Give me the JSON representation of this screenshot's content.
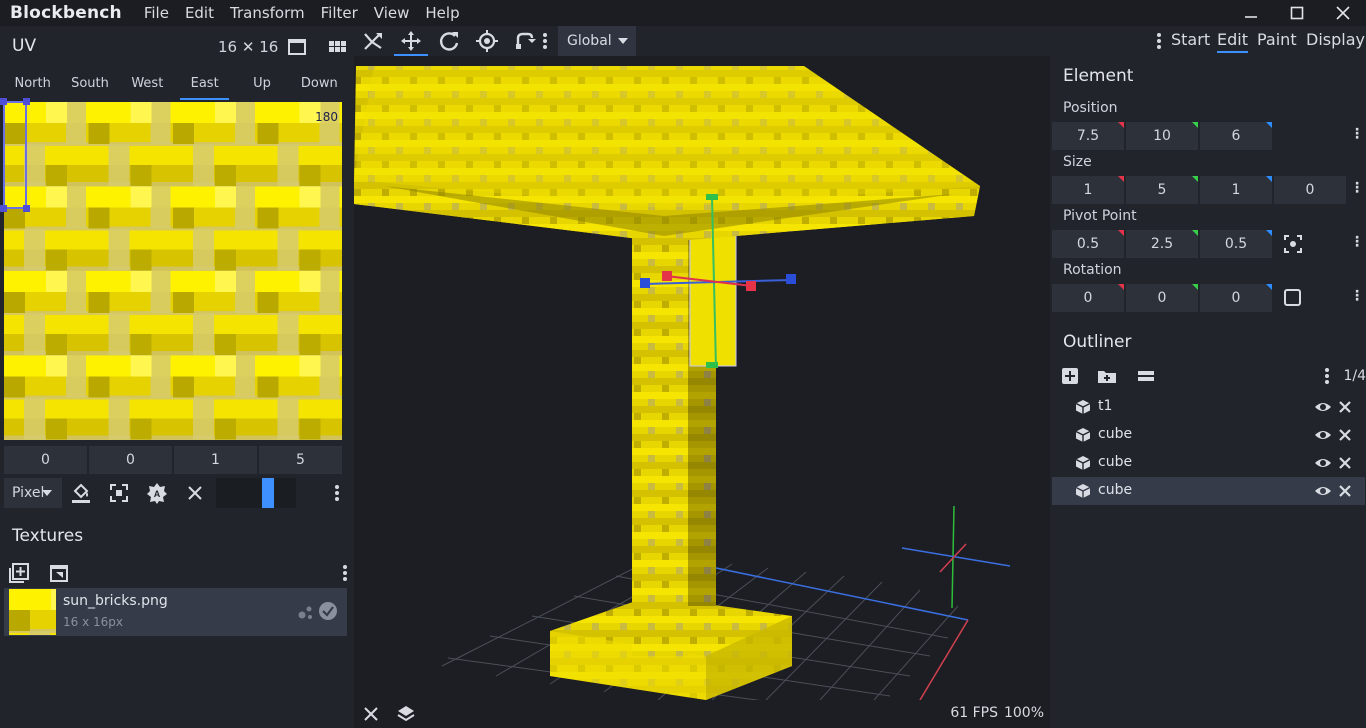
{
  "app": {
    "name": "Blockbench",
    "menu": [
      "File",
      "Edit",
      "Transform",
      "Filter",
      "View",
      "Help"
    ]
  },
  "uv_panel": {
    "title": "UV",
    "size_label": "16 ✕ 16",
    "faces": [
      "North",
      "South",
      "West",
      "East",
      "Up",
      "Down"
    ],
    "active_face": "East",
    "rotation_label": "180",
    "uv_values": [
      "0",
      "0",
      "1",
      "5"
    ],
    "pixel_mode": "Pixel"
  },
  "textures": {
    "title": "Textures",
    "items": [
      {
        "name": "sun_bricks.png",
        "dims": "16 x 16px"
      }
    ]
  },
  "toolbar": {
    "space_select": "Global"
  },
  "modes": {
    "items": [
      "Start",
      "Edit",
      "Paint",
      "Display"
    ],
    "active": "Edit"
  },
  "element": {
    "title": "Element",
    "position_label": "Position",
    "position": [
      "7.5",
      "10",
      "6"
    ],
    "size_label": "Size",
    "size": [
      "1",
      "5",
      "1",
      "0"
    ],
    "pivot_label": "Pivot Point",
    "pivot": [
      "0.5",
      "2.5",
      "0.5"
    ],
    "rotation_label": "Rotation",
    "rotation": [
      "0",
      "0",
      "0"
    ]
  },
  "outliner": {
    "title": "Outliner",
    "count": "1/4",
    "items": [
      {
        "name": "t1"
      },
      {
        "name": "cube"
      },
      {
        "name": "cube"
      },
      {
        "name": "cube"
      }
    ],
    "selected_index": 3
  },
  "status": {
    "fps": "61 FPS",
    "zoom": "100%"
  },
  "colors": {
    "accent": "#3e90ff",
    "gold": "#e6d800",
    "panel": "#21252b",
    "viewport": "#1c1e24"
  }
}
